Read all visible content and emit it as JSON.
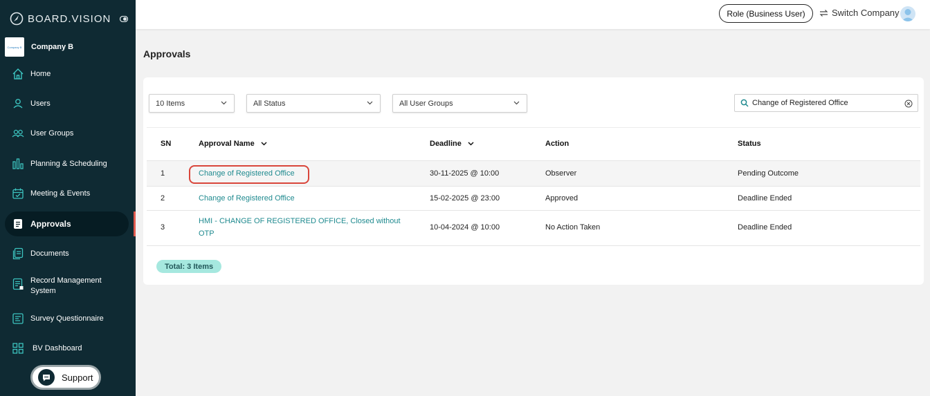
{
  "brand": {
    "name": "BOARD.VISION"
  },
  "company": {
    "name": "Company B",
    "logo_text": "Company B"
  },
  "sidebar": {
    "items": [
      {
        "label": "Home",
        "icon": "home-icon"
      },
      {
        "label": "Users",
        "icon": "user-icon"
      },
      {
        "label": "User Groups",
        "icon": "user-group-icon"
      },
      {
        "label": "Planning & Scheduling",
        "icon": "planning-chart-icon"
      },
      {
        "label": "Meeting & Events",
        "icon": "calendar-icon"
      },
      {
        "label": "Approvals",
        "icon": "approvals-icon",
        "active": true
      },
      {
        "label": "Documents",
        "icon": "documents-icon"
      },
      {
        "label": "Record Management System",
        "icon": "record-icon"
      },
      {
        "label": "Survey Questionnaire",
        "icon": "survey-icon"
      },
      {
        "label": "BV Dashboard",
        "icon": "dashboard-grid-icon"
      }
    ]
  },
  "support": {
    "label": "Support"
  },
  "header": {
    "role_label": "Role (Business User)",
    "switch_label": "Switch Company"
  },
  "page": {
    "title": "Approvals"
  },
  "filters": {
    "items_per_page": "10 Items",
    "status": "All Status",
    "user_groups": "All User Groups",
    "search_value": "Change of Registered Office"
  },
  "table": {
    "columns": [
      "SN",
      "Approval Name",
      "Deadline",
      "Action",
      "Status"
    ],
    "rows": [
      {
        "sn": "1",
        "name": "Change of Registered Office",
        "deadline": "30-11-2025 @ 10:00",
        "action": "Observer",
        "status": "Pending Outcome"
      },
      {
        "sn": "2",
        "name": "Change of Registered Office",
        "deadline": "15-02-2025 @ 23:00",
        "action": "Approved",
        "status": "Deadline Ended"
      },
      {
        "sn": "3",
        "name_line1": "HMI - CHANGE OF REGISTERED OFFICE, Closed without",
        "name_line2": "OTP",
        "deadline": "10-04-2024 @ 10:00",
        "action": "No Action Taken",
        "status": "Deadline Ended"
      }
    ]
  },
  "total_label": "Total: 3 Items",
  "colors": {
    "sidebar_bg": "#0f2a33",
    "link": "#1f8a8f",
    "highlight": "#d9453a",
    "total_badge": "#a6e8df"
  }
}
